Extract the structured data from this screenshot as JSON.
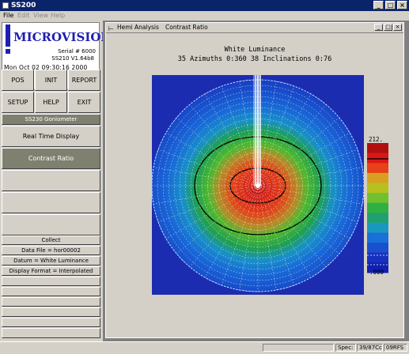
{
  "app": {
    "title": "SS200",
    "window_buttons": [
      "_",
      "□",
      "×"
    ]
  },
  "menu": [
    "File",
    "Edit",
    "View",
    "Help"
  ],
  "left_panel": {
    "brand": "MICROVISION",
    "serial": "Serial # 6000",
    "version": "SS210 V1.64b8",
    "datetime": "Mon Oct 02 09:30:16 2000",
    "grid_buttons": [
      "POS",
      "INIT",
      "REPORT",
      "SETUP",
      "HELP",
      "EXIT"
    ],
    "mode_label": "SS230 Goniometer",
    "nav_buttons": [
      "Real Time Display",
      "Contrast Ratio"
    ],
    "collect": "Collect",
    "data_file": "Data File = hor00002",
    "datum": "Datum = White Luminance",
    "display_format": "Display Format = Interpolated"
  },
  "child_window": {
    "name": "Hemi Analysis",
    "subtitle": "Contrast Ratio",
    "buttons": [
      "_",
      "□",
      "×"
    ]
  },
  "chart": {
    "title": "White Luminance",
    "subtitle": "35 Azimuths 0:360  38 Inclinations 0:76",
    "scale_max": "212.",
    "scale_min": ".000",
    "colors": {
      "background": "#1c2cb0",
      "scale": [
        "#b01010",
        "#d81818",
        "#e84018",
        "#d8a020",
        "#b8c020",
        "#70c030",
        "#30b040",
        "#20a070",
        "#1898c0",
        "#1870d8",
        "#1850d0",
        "#1830c0",
        "#1020b0"
      ]
    }
  },
  "status_bar": {
    "spec": "Spec:",
    "value1": "39/87Cc",
    "value2": "09RFS"
  }
}
